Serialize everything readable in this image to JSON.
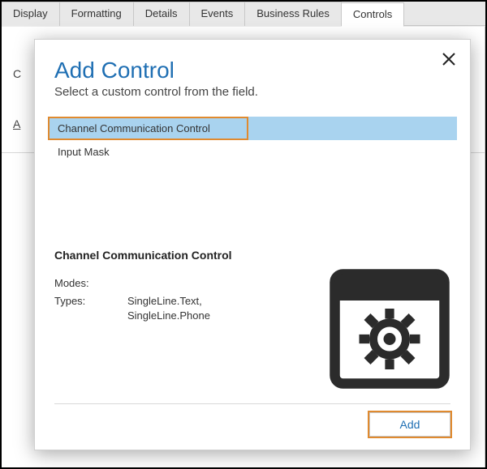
{
  "tabs": [
    {
      "label": "Display"
    },
    {
      "label": "Formatting"
    },
    {
      "label": "Details"
    },
    {
      "label": "Events"
    },
    {
      "label": "Business Rules"
    },
    {
      "label": "Controls"
    }
  ],
  "dialog": {
    "title": "Add Control",
    "subtitle": "Select a custom control from the field.",
    "close_label": "×",
    "list": [
      {
        "label": "Channel Communication Control",
        "selected": true
      },
      {
        "label": "Input Mask",
        "selected": false
      }
    ],
    "details": {
      "title": "Channel Communication Control",
      "modes_label": "Modes:",
      "modes_value": "",
      "types_label": "Types:",
      "types_value": "SingleLine.Text,\nSingleLine.Phone"
    },
    "add_button": "Add"
  },
  "bg_marks": {
    "m1": "C",
    "m2": "A"
  }
}
